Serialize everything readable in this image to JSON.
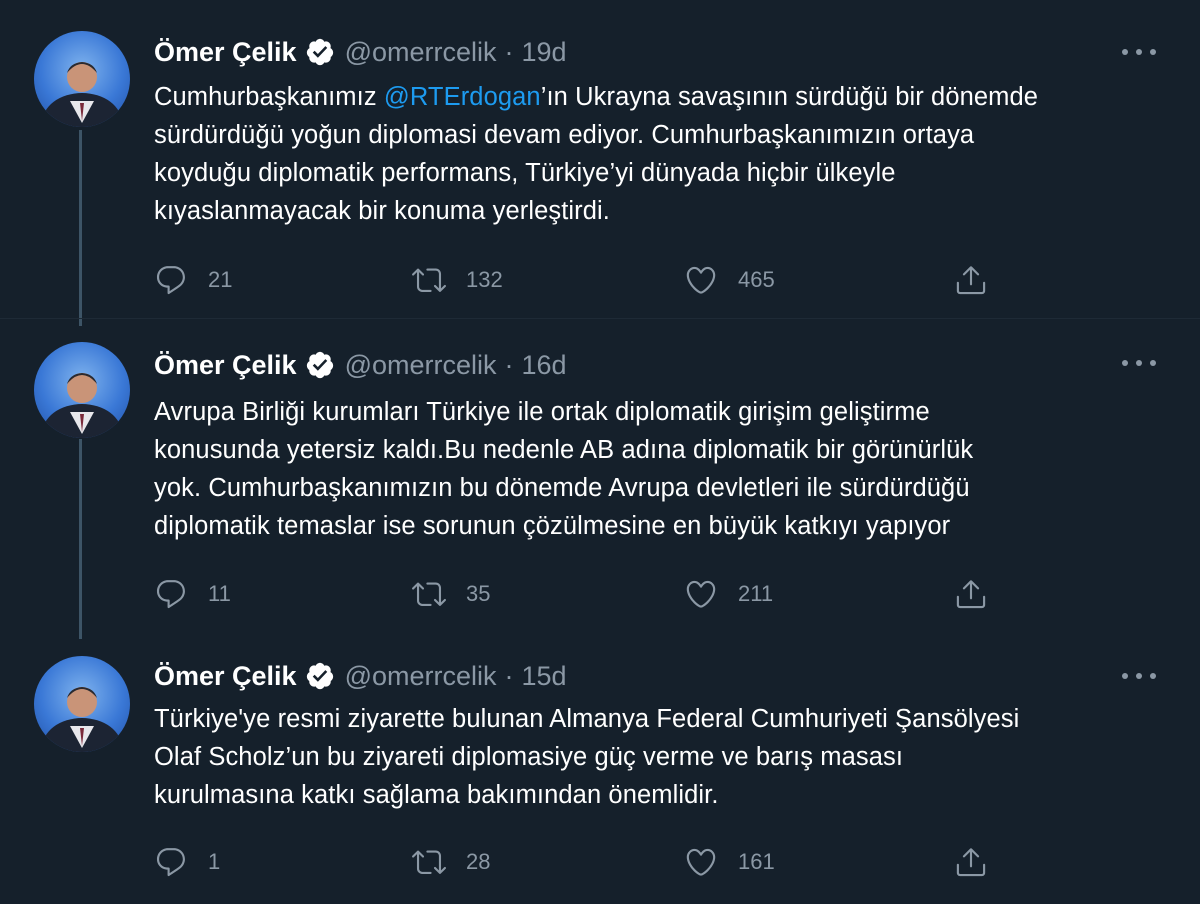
{
  "tweets": [
    {
      "author_name": "Ömer Çelik",
      "handle": "@omerrcelik",
      "separator": "·",
      "time": "19d",
      "text_lines": [
        {
          "before": "Cumhurbaşkanımız ",
          "mention": "@RTErdogan",
          "after": "’ın Ukrayna savaşının sürdüğü bir dönemde"
        },
        {
          "text": "sürdürdüğü yoğun diplomasi devam ediyor. Cumhurbaşkanımızın ortaya"
        },
        {
          "text": "koyduğu diplomatik performans, Türkiye’yi dünyada hiçbir ülkeyle"
        },
        {
          "text": "kıyaslanmayacak bir konuma yerleştirdi."
        }
      ],
      "replies": "21",
      "retweets": "132",
      "likes": "465"
    },
    {
      "author_name": "Ömer Çelik",
      "handle": "@omerrcelik",
      "separator": "·",
      "time": "16d",
      "text_lines": [
        {
          "text": "Avrupa Birliği kurumları Türkiye ile ortak diplomatik girişim geliştirme"
        },
        {
          "text": "konusunda yetersiz kaldı.Bu nedenle AB adına diplomatik bir görünürlük"
        },
        {
          "text": "yok. Cumhurbaşkanımızın bu dönemde Avrupa devletleri ile sürdürdüğü"
        },
        {
          "text": "diplomatik temaslar ise sorunun çözülmesine en büyük katkıyı yapıyor"
        }
      ],
      "replies": "11",
      "retweets": "35",
      "likes": "211"
    },
    {
      "author_name": "Ömer Çelik",
      "handle": "@omerrcelik",
      "separator": "·",
      "time": "15d",
      "text_lines": [
        {
          "text": "Türkiye'ye resmi ziyarette bulunan Almanya Federal Cumhuriyeti Şansölyesi"
        },
        {
          "text": "Olaf Scholz’un bu ziyareti diplomasiye güç verme ve barış masası"
        },
        {
          "text": "kurulmasına katkı sağlama bakımından önemlidir."
        }
      ],
      "replies": "1",
      "retweets": "28",
      "likes": "161"
    }
  ],
  "colors": {
    "background": "#15202b",
    "text": "#ffffff",
    "muted": "#8b98a5",
    "mention": "#1d9bf0",
    "thread_line": "#3d5466"
  },
  "icons": {
    "verified": "verified-badge-icon",
    "more": "more-dots-icon",
    "reply": "reply-icon",
    "retweet": "retweet-icon",
    "like": "heart-icon",
    "share": "share-icon"
  }
}
